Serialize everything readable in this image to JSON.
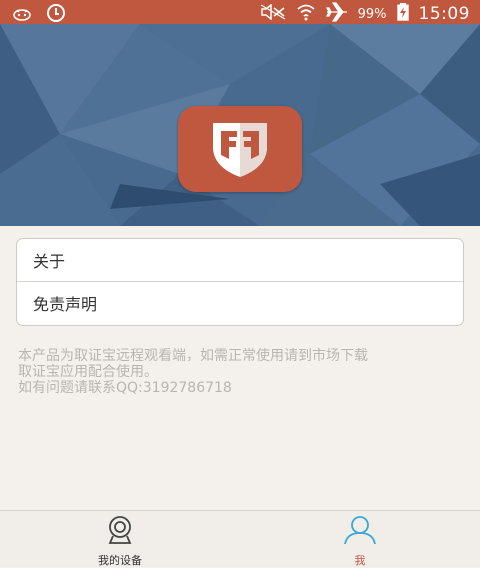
{
  "status_bar": {
    "battery_percent": "99%",
    "time": "15:09",
    "icons": [
      "notification-icon",
      "sync-icon",
      "mute-icon",
      "wifi-icon",
      "airplane-mode-icon",
      "battery-charging-icon"
    ]
  },
  "colors": {
    "accent": "#c0573f",
    "banner": "#486a8e",
    "background": "#f4f0eb",
    "muted_text": "#b9b6b2"
  },
  "menu": {
    "items": [
      {
        "label": "关于"
      },
      {
        "label": "免责声明"
      }
    ]
  },
  "info": {
    "line1": "本产品为取证宝远程观看端，如需正常使用请到市场下载",
    "line2": "取证宝应用配合使用。",
    "line3": "如有问题请联系QQ:3192786718"
  },
  "tabbar": {
    "tabs": [
      {
        "label": "我的设备",
        "icon": "webcam-icon",
        "active": false
      },
      {
        "label": "我",
        "icon": "person-icon",
        "active": true
      }
    ]
  }
}
